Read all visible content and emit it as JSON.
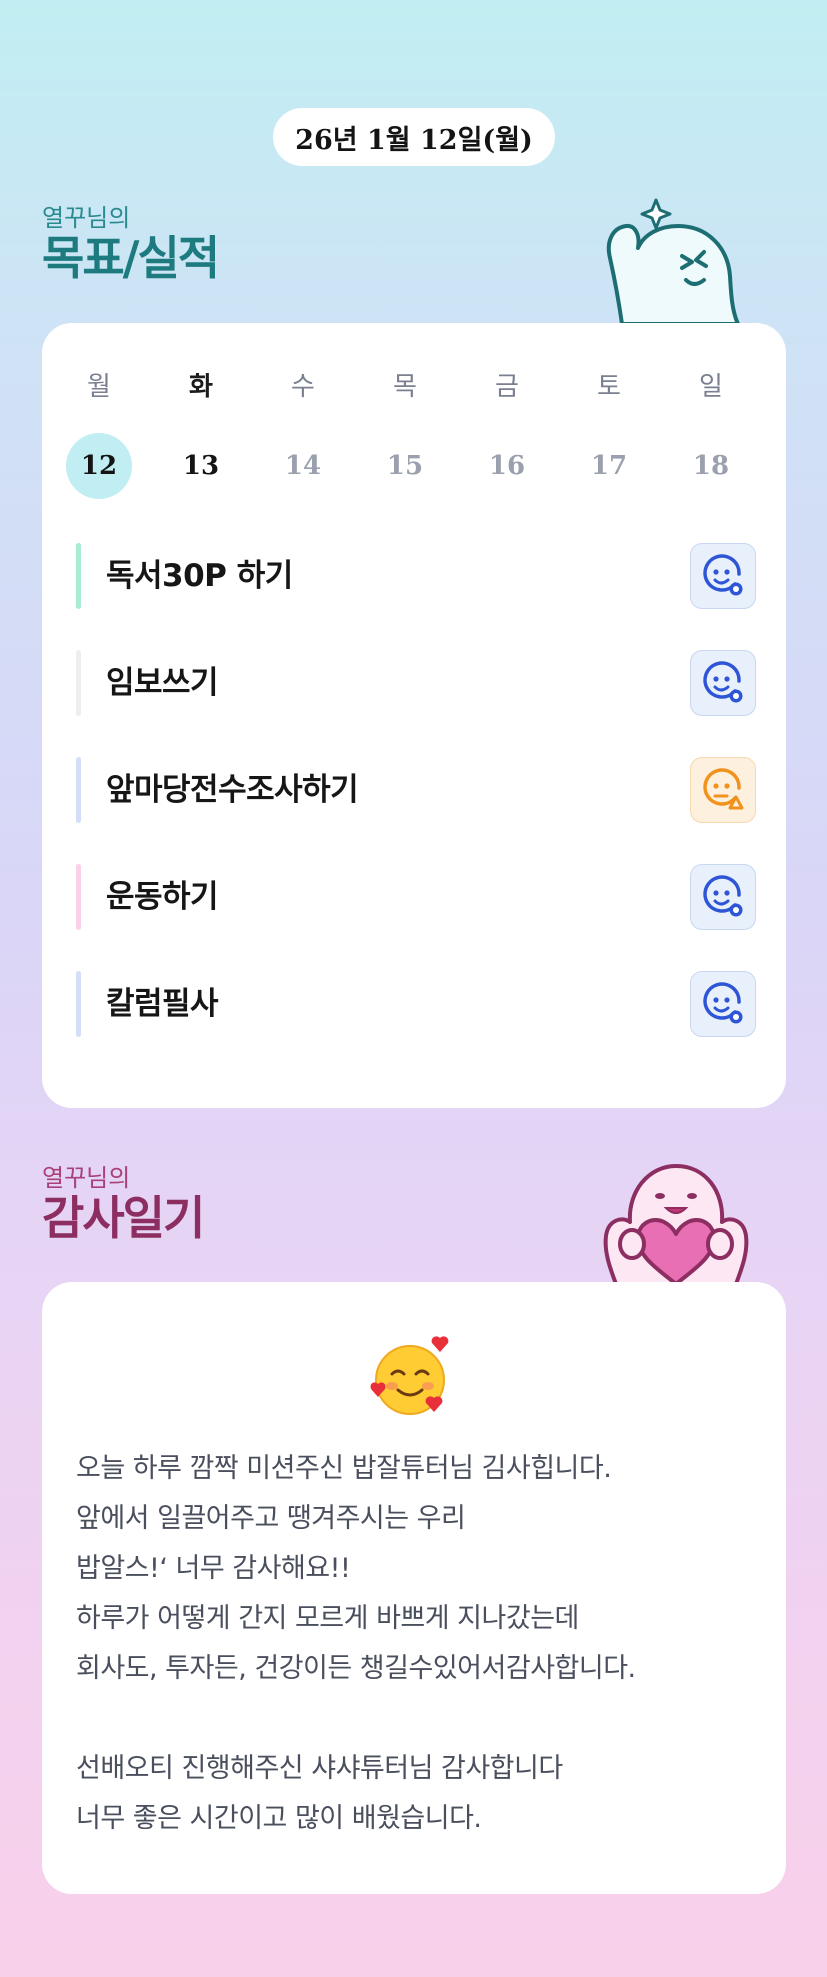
{
  "header": {
    "date": "26년 1월 12일(월)"
  },
  "goals_section": {
    "subtitle": "열꾸님의",
    "title": "목표/실적"
  },
  "week": {
    "days": [
      "월",
      "화",
      "수",
      "목",
      "금",
      "토",
      "일"
    ],
    "dates": [
      "12",
      "13",
      "14",
      "15",
      "16",
      "17",
      "18"
    ],
    "selected_index": 0,
    "today_index": 1
  },
  "goals": [
    {
      "text": "독서30P  하기",
      "bar_color": "#a8ecd2",
      "status": "done"
    },
    {
      "text": "임보쓰기",
      "bar_color": "#eeeeee",
      "status": "done"
    },
    {
      "text": "앞마당전수조사하기",
      "bar_color": "#d4def9",
      "status": "partial"
    },
    {
      "text": "운동하기",
      "bar_color": "#fbd0e8",
      "status": "done"
    },
    {
      "text": "칼럼필사",
      "bar_color": "#d4def9",
      "status": "done"
    }
  ],
  "status_icons": {
    "done": {
      "icon": "smile-check-icon",
      "color": "#2e55d6"
    },
    "partial": {
      "icon": "smile-warning-icon",
      "color": "#f0921c"
    }
  },
  "thanks_section": {
    "subtitle": "열꾸님의",
    "title": "감사일기"
  },
  "diary": {
    "emoji": "smiling-face-with-hearts-icon",
    "text": "오늘 하루 깜짝 미션주신 밥잘튜터님 김사힙니다.\n앞에서 일끌어주고 땡겨주시는 우리\n밥알스!‘ 너무 감사해요!!\n하루가 어떻게 간지 모르게 바쁘게 지나갔는데\n회사도, 투자든, 건강이든 챙길수있어서감사합니다.\n\n선배오티 진행해주신 샤샤튜터님 감사합니다\n너무 좋은 시간이고 많이 배웠습니다."
  }
}
